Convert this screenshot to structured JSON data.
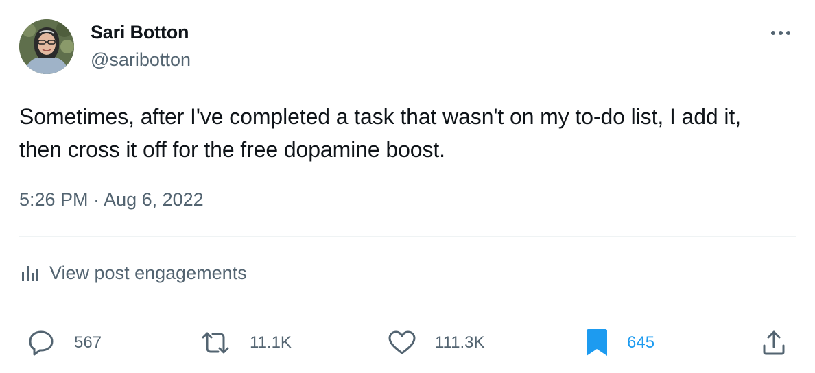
{
  "author": {
    "display_name": "Sari Botton",
    "handle": "@saribotton"
  },
  "tweet": {
    "text": "Sometimes, after I've completed a task that wasn't on my to-do list, I add it, then cross it off for the free dopamine boost.",
    "timestamp": "5:26 PM · Aug 6, 2022"
  },
  "engagements": {
    "label": "View post engagements",
    "icon": "bar-chart-icon"
  },
  "actions": {
    "reply": {
      "icon": "reply-icon",
      "count": "567"
    },
    "repost": {
      "icon": "repost-icon",
      "count": "11.1K"
    },
    "like": {
      "icon": "heart-icon",
      "count": "111.3K"
    },
    "bookmark": {
      "icon": "bookmark-icon",
      "count": "645",
      "active": true
    },
    "share": {
      "icon": "share-icon"
    }
  },
  "colors": {
    "text_primary": "#0f1419",
    "text_secondary": "#536471",
    "accent": "#1d9bf0",
    "divider": "#eff3f4"
  }
}
